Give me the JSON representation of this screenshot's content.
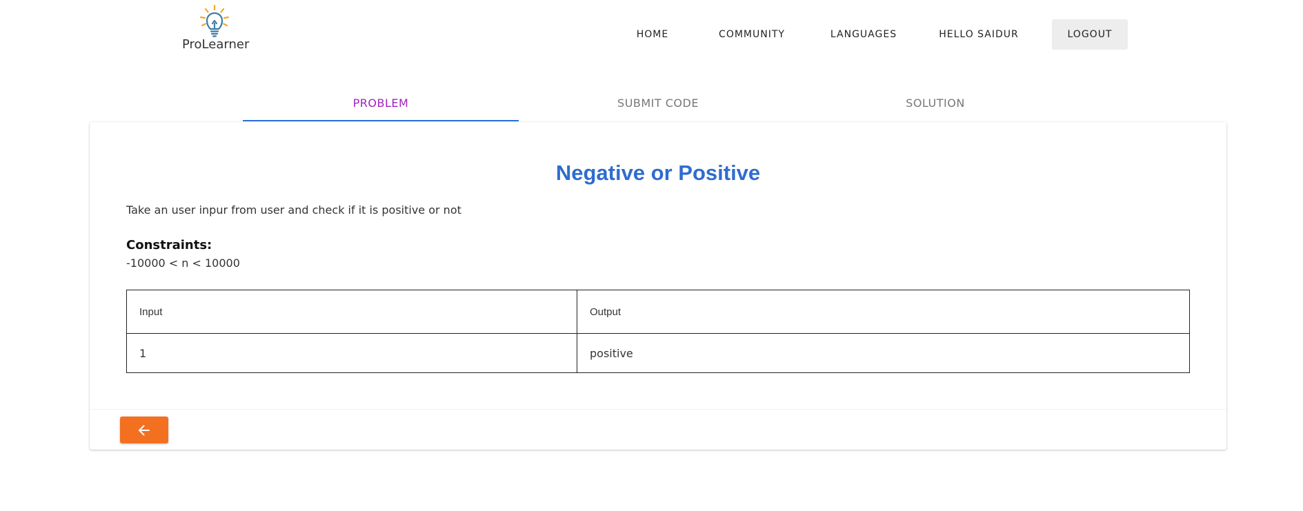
{
  "brand": {
    "name": "ProLearner",
    "icon": "lightbulb-icon",
    "icon_color": "#f5a623",
    "bulb_color": "#3a7ca5"
  },
  "nav": {
    "home": "HOME",
    "community": "COMMUNITY",
    "languages": "LANGUAGES",
    "user": "HELLO SAIDUR",
    "logout": "LOGOUT"
  },
  "tabs": [
    {
      "label": "PROBLEM",
      "active": true
    },
    {
      "label": "SUBMIT CODE",
      "active": false
    },
    {
      "label": "SOLUTION",
      "active": false
    }
  ],
  "problem": {
    "title": "Negative or Positive",
    "description": "Take an user inpur from user and check if it is positive or not",
    "constraints_label": "Constraints:",
    "constraints_value": "-10000 < n < 10000"
  },
  "io_table": {
    "headers": [
      "Input",
      "Output"
    ],
    "rows": [
      [
        "1",
        "positive"
      ]
    ]
  },
  "back_button": {
    "icon": "arrow-left-icon",
    "color": "#f37021"
  },
  "colors": {
    "accent_title": "#2f6ccf",
    "active_tab_text": "#a020c0",
    "active_tab_indicator": "#2a6fdb"
  }
}
